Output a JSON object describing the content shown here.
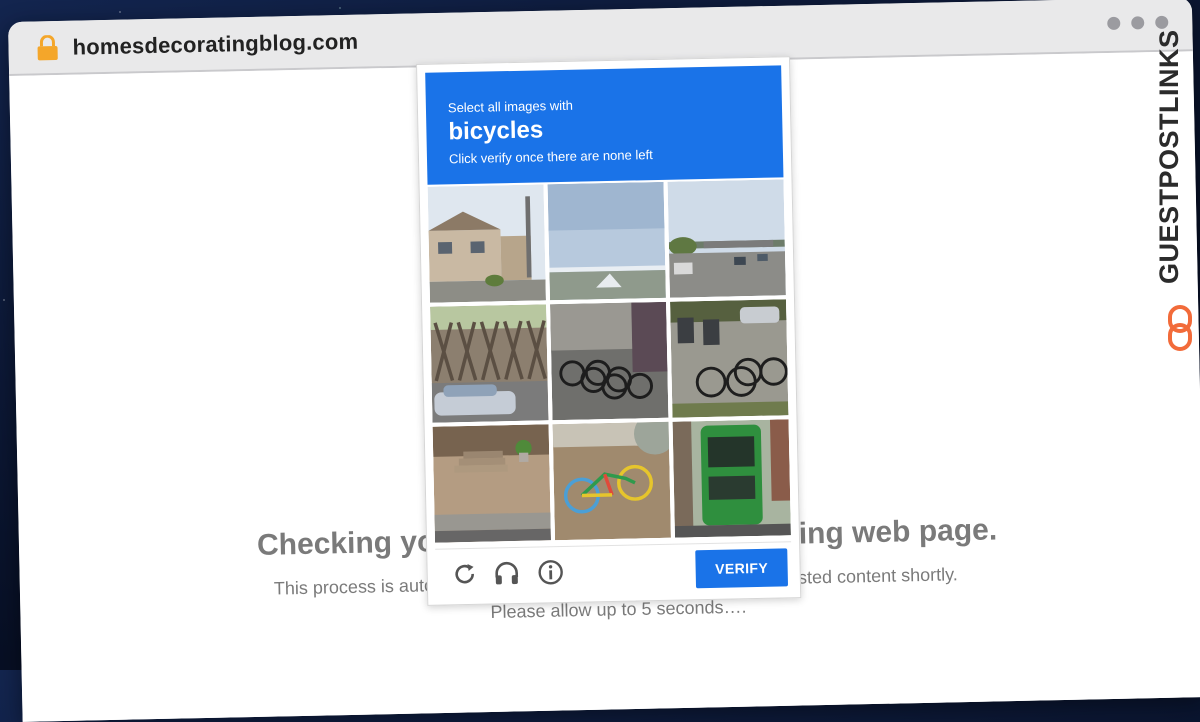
{
  "browser": {
    "url": "homesdecoratingblog.com"
  },
  "page": {
    "heading": "Checking your browser before accessing web page.",
    "subline": "This process is automatic. Your browser will redirect to your requested content shortly.",
    "allow": "Please allow up to 5 seconds…."
  },
  "brand": {
    "text": "GUESTPOSTLINKS"
  },
  "captcha": {
    "select_label": "Select all images with",
    "target": "bicycles",
    "hint": "Click verify once there are none left",
    "verify_label": "VERIFY",
    "tiles": [
      "houses-street-tile",
      "sky-bridge-tile",
      "highway-cars-tile",
      "fence-car-tile",
      "parked-bicycles-tile",
      "bicycle-rack-tile",
      "stone-steps-tile",
      "colorful-bicycle-tile",
      "green-bus-tile"
    ]
  },
  "colors": {
    "accent": "#1a73e8",
    "lock": "#f4a62a",
    "brand_chain": "#f26b3a"
  }
}
